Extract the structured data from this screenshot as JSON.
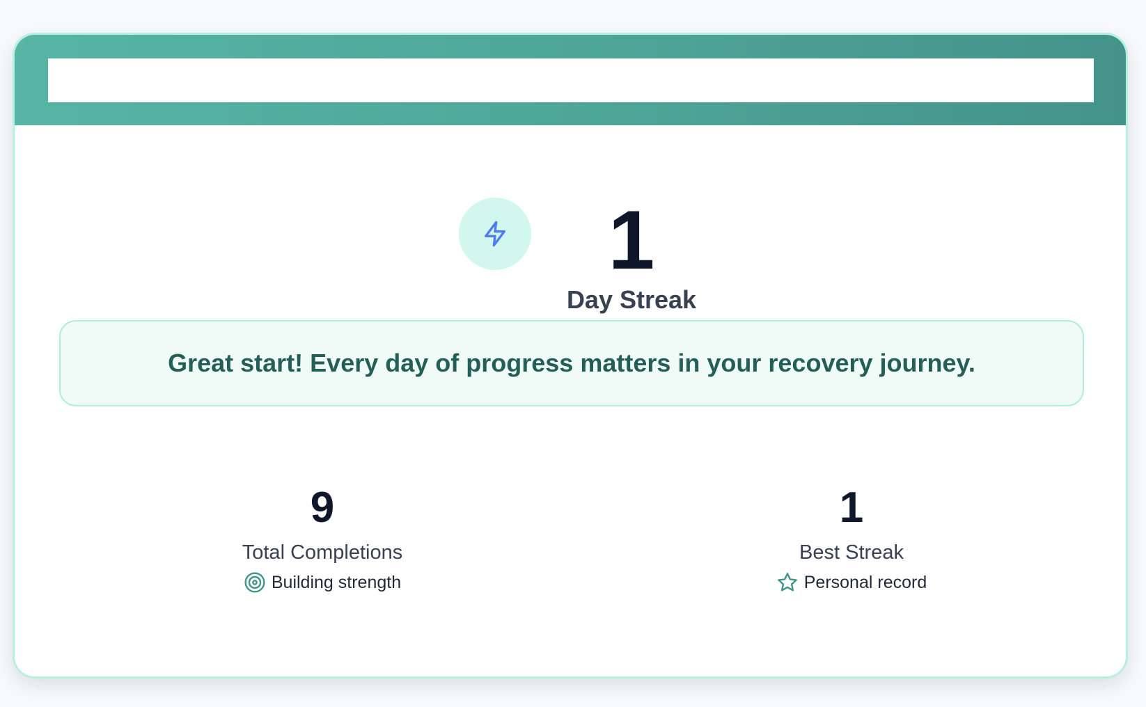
{
  "header": {
    "title": ""
  },
  "streak": {
    "value": "1",
    "label": "Day Streak",
    "icon": "lightning-icon",
    "icon_color": "#4f7df0",
    "icon_bg": "#d1f7ef"
  },
  "message": {
    "text": "Great start! Every day of progress matters in your recovery journey."
  },
  "stats": [
    {
      "value": "9",
      "label": "Total Completions",
      "sub_icon": "target-icon",
      "sub_text": "Building strength"
    },
    {
      "value": "1",
      "label": "Best Streak",
      "sub_icon": "star-icon",
      "sub_text": "Personal record"
    }
  ],
  "colors": {
    "accent": "#4ea596",
    "border": "#b6f0e0",
    "message_bg": "#f0fbf8",
    "message_text": "#245f57"
  }
}
